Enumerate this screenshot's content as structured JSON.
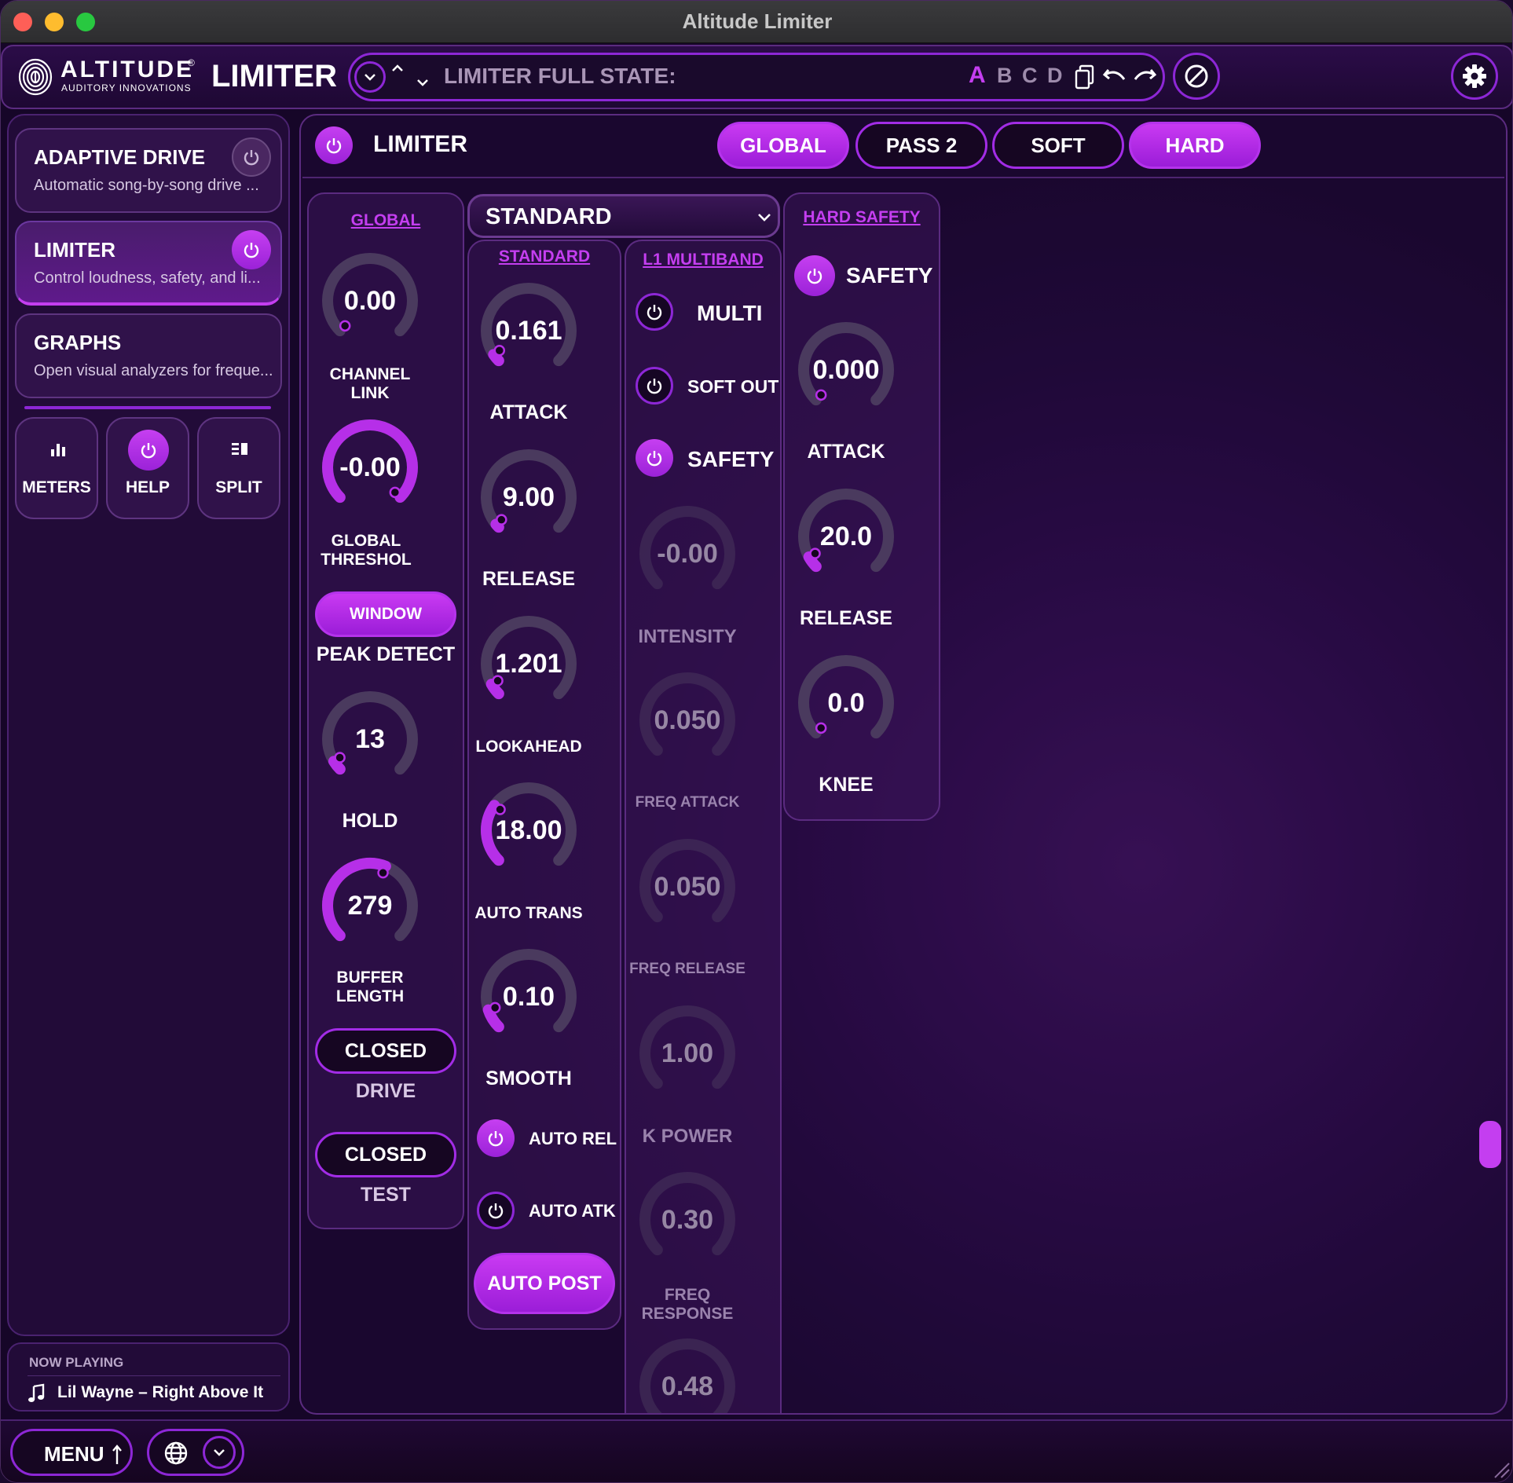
{
  "window": {
    "title": "Altitude Limiter"
  },
  "header": {
    "brand": "ALTITUDE",
    "brand_mark": "®",
    "brand_sub": "AUDITORY INNOVATIONS",
    "plugin_name": "LIMITER",
    "preset_label": "LIMITER FULL STATE:",
    "slots": [
      "A",
      "B",
      "C",
      "D"
    ],
    "active_slot": "A"
  },
  "sidebar": {
    "cards": [
      {
        "title": "ADAPTIVE DRIVE",
        "subtitle": "Automatic song-by-song drive ...",
        "on": false
      },
      {
        "title": "LIMITER",
        "subtitle": "Control loudness, safety, and li...",
        "on": true
      },
      {
        "title": "GRAPHS",
        "subtitle": "Open visual analyzers for freque..."
      }
    ],
    "buttons": {
      "meters": "METERS",
      "help": "HELP",
      "split": "SPLIT"
    },
    "now_playing": {
      "label": "NOW PLAYING",
      "track": "Lil Wayne – Right Above It"
    }
  },
  "main": {
    "title": "LIMITER",
    "tabs": [
      {
        "label": "GLOBAL",
        "active": true
      },
      {
        "label": "PASS 2",
        "active": false
      },
      {
        "label": "SOFT",
        "active": false
      },
      {
        "label": "HARD",
        "active": true
      }
    ],
    "global": {
      "header": "GLOBAL",
      "channel_link": {
        "value": "0.00",
        "label": "CHANNEL LINK",
        "level": 0
      },
      "global_threshold": {
        "value": "-0.00",
        "label": "GLOBAL THRESHOL",
        "level": 1
      },
      "peak_detect": {
        "button": "WINDOW",
        "label": "PEAK DETECT"
      },
      "hold": {
        "value": "13",
        "label": "HOLD",
        "level": 0.05
      },
      "buffer_length": {
        "value": "279",
        "label": "BUFFER LENGTH",
        "level": 0.58
      },
      "drive": {
        "button": "CLOSED",
        "label": "DRIVE"
      },
      "test": {
        "button": "CLOSED",
        "label": "TEST"
      }
    },
    "standard": {
      "dropdown": "STANDARD",
      "header": "STANDARD",
      "attack": {
        "value": "0.161",
        "label": "ATTACK",
        "level": 0.04
      },
      "release": {
        "value": "9.00",
        "label": "RELEASE",
        "level": 0.02
      },
      "lookahead": {
        "value": "1.201",
        "label": "LOOKAHEAD",
        "level": 0.06
      },
      "auto_trans": {
        "value": "18.00",
        "label": "AUTO TRANS",
        "level": 0.3
      },
      "smooth": {
        "value": "0.10",
        "label": "SMOOTH",
        "level": 0.1
      },
      "auto_rel": {
        "label": "AUTO REL",
        "on": true
      },
      "auto_atk": {
        "label": "AUTO ATK",
        "on": false
      },
      "auto_post": "AUTO POST"
    },
    "multiband": {
      "header": "L1 MULTIBAND",
      "multi": {
        "label": "MULTI",
        "on": false
      },
      "soft_out": {
        "label": "SOFT OUT",
        "on": false
      },
      "safety": {
        "label": "SAFETY",
        "on": true
      },
      "intensity": {
        "value": "-0.00",
        "label": "INTENSITY"
      },
      "freq_attack": {
        "value": "0.050",
        "label": "FREQ ATTACK"
      },
      "freq_release": {
        "value": "0.050",
        "label": "FREQ RELEASE"
      },
      "k_power": {
        "value": "1.00",
        "label": "K POWER"
      },
      "freq_response": {
        "value": "0.30",
        "label": "FREQ RESPONSE"
      },
      "extra": {
        "value": "0.48"
      }
    },
    "hard_safety": {
      "header": "HARD SAFETY",
      "safety": {
        "label": "SAFETY",
        "on": true
      },
      "attack": {
        "value": "0.000",
        "label": "ATTACK",
        "level": 0
      },
      "release": {
        "value": "20.0",
        "label": "RELEASE",
        "level": 0.06
      },
      "knee": {
        "value": "0.0",
        "label": "KNEE",
        "level": 0
      }
    }
  },
  "footer": {
    "menu": "MENU"
  },
  "colors": {
    "accent": "#b62fe8",
    "track": "#4a3a5e",
    "bg": "#2a0b46"
  }
}
